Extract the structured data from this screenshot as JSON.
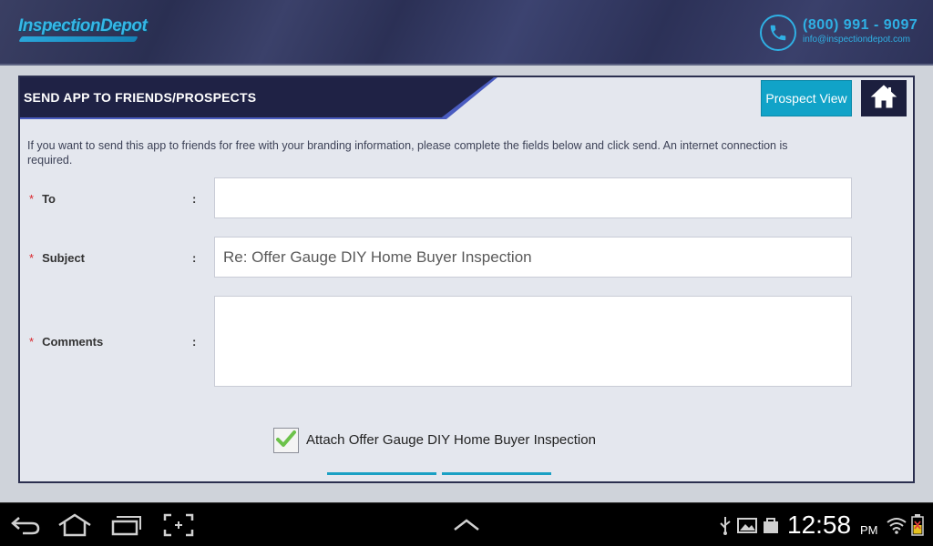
{
  "header": {
    "logo_text": "InspectionDepot",
    "phone": "(800) 991 - 9097",
    "email": "info@inspectiondepot.com"
  },
  "panel": {
    "title": "SEND APP TO FRIENDS/PROSPECTS",
    "prospect_view_label": "Prospect View",
    "instructions": "If you want to send this app to friends for free with your branding information, please complete the fields below and click send. An internet connection is required."
  },
  "form": {
    "required_mark": "*",
    "colon": ":",
    "to_label": "To",
    "to_value": "",
    "subject_label": "Subject",
    "subject_value": "Re: Offer Gauge DIY Home Buyer Inspection",
    "comments_label": "Comments",
    "comments_value": "",
    "attach_label": "Attach Offer Gauge DIY Home Buyer Inspection",
    "attach_checked": true
  },
  "system_bar": {
    "time": "12:58",
    "ampm": "PM"
  },
  "colors": {
    "header_bg": "#2f3459",
    "accent_blue": "#11a3c8",
    "title_bar": "#1f2245",
    "required_red": "#d9252b"
  },
  "icons": [
    "phone-icon",
    "home-icon",
    "check-icon",
    "back-icon",
    "nav-home-icon",
    "recent-apps-icon",
    "screenshot-icon",
    "chevron-up-icon",
    "usb-icon",
    "gallery-icon",
    "bag-icon",
    "wifi-icon",
    "battery-icon"
  ]
}
